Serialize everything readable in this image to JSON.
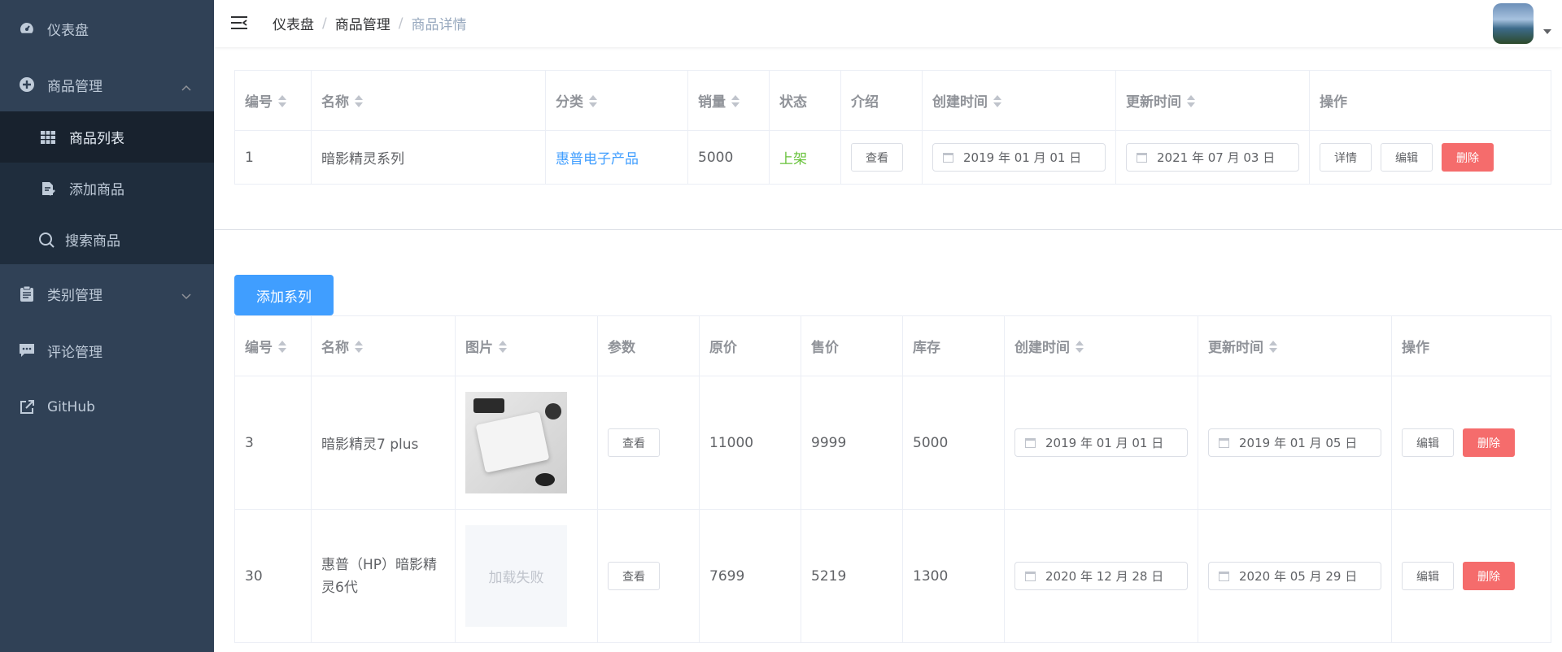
{
  "sidebar": {
    "items": [
      {
        "label": "仪表盘",
        "icon": "dashboard-icon"
      },
      {
        "label": "商品管理",
        "icon": "plus-circle-icon"
      },
      {
        "label": "类别管理",
        "icon": "clipboard-icon"
      },
      {
        "label": "评论管理",
        "icon": "comment-icon"
      },
      {
        "label": "GitHub",
        "icon": "external-link-icon"
      }
    ],
    "submenu": [
      {
        "label": "商品列表",
        "icon": "grid-icon"
      },
      {
        "label": "添加商品",
        "icon": "edit-document-icon"
      },
      {
        "label": "搜索商品",
        "icon": "search-icon"
      }
    ]
  },
  "header": {
    "breadcrumb": [
      "仪表盘",
      "商品管理",
      "商品详情"
    ],
    "separator": "/"
  },
  "product_table": {
    "headers": [
      "编号",
      "名称",
      "分类",
      "销量",
      "状态",
      "介绍",
      "创建时间",
      "更新时间",
      "操作"
    ],
    "row": {
      "id": "1",
      "name": "暗影精灵系列",
      "category": "惠普电子产品",
      "sales": "5000",
      "status": "上架",
      "intro_button": "查看",
      "created": "2019 年 01 月 01 日",
      "updated": "2021 年 07 月 03 日",
      "detail_button": "详情",
      "edit_button": "编辑",
      "delete_button": "删除"
    }
  },
  "add_series_button": "添加系列",
  "series_table": {
    "headers": [
      "编号",
      "名称",
      "图片",
      "参数",
      "原价",
      "售价",
      "库存",
      "创建时间",
      "更新时间",
      "操作"
    ],
    "rows": [
      {
        "id": "3",
        "name": "暗影精灵7 plus",
        "image": "laptop-photo",
        "params_button": "查看",
        "original_price": "11000",
        "price": "9999",
        "stock": "5000",
        "created": "2019 年 01 月 01 日",
        "updated": "2019 年 01 月 05 日",
        "edit_button": "编辑",
        "delete_button": "删除"
      },
      {
        "id": "30",
        "name": "惠普（HP）暗影精灵6代",
        "image_failed_text": "加载失败",
        "params_button": "查看",
        "original_price": "7699",
        "price": "5219",
        "stock": "1300",
        "created": "2020 年 12 月 28 日",
        "updated": "2020 年 05 月 29 日",
        "edit_button": "编辑",
        "delete_button": "删除"
      }
    ]
  },
  "colors": {
    "sidebar_bg": "#304156",
    "submenu_bg": "#1f2d3d",
    "primary": "#409eff",
    "danger": "#f56c6c",
    "success": "#67c23a"
  }
}
